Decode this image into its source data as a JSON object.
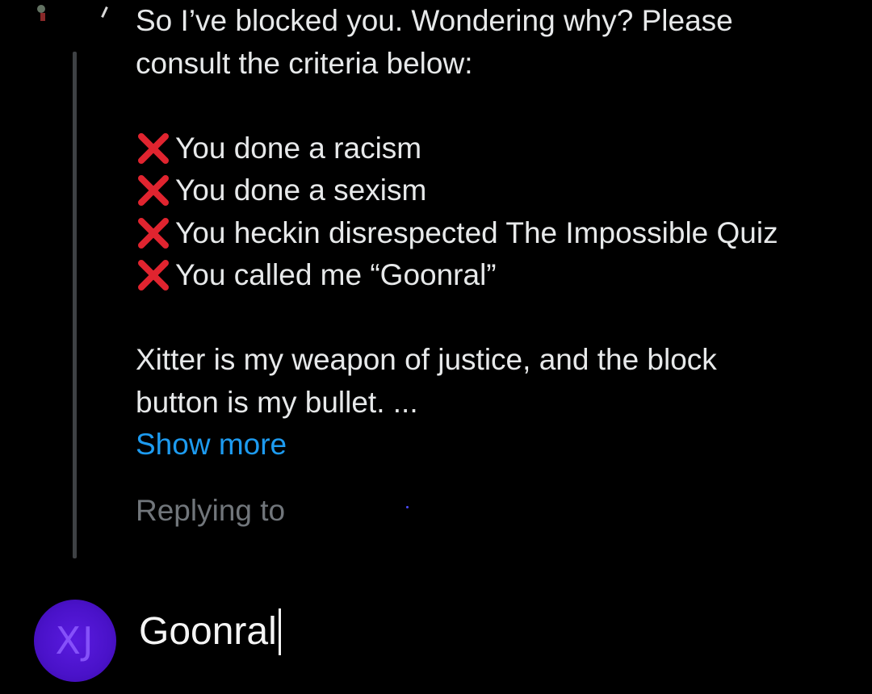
{
  "tweet": {
    "lines": [
      "So I’ve blocked you. Wondering why? Please",
      "consult the criteria below:"
    ],
    "criteria": [
      "You done a racism",
      "You done a sexism",
      "You heckin disrespected The Impossible Quiz",
      "You called me “Goonral”"
    ],
    "closing_lines": [
      "Xitter is my weapon of justice, and the block",
      "button is my bullet. ..."
    ],
    "show_more": "Show more",
    "criteria_icon": "cross-mark-icon",
    "colors": {
      "text": "#e7e9ea",
      "link": "#1d9bf0",
      "muted": "#71767b",
      "cross": "#e0242f"
    }
  },
  "reply": {
    "replying_to_label": "Replying to"
  },
  "composer": {
    "avatar_initials": "XJ",
    "avatar_color": "#4a12c9",
    "input_value": "Goonral"
  }
}
